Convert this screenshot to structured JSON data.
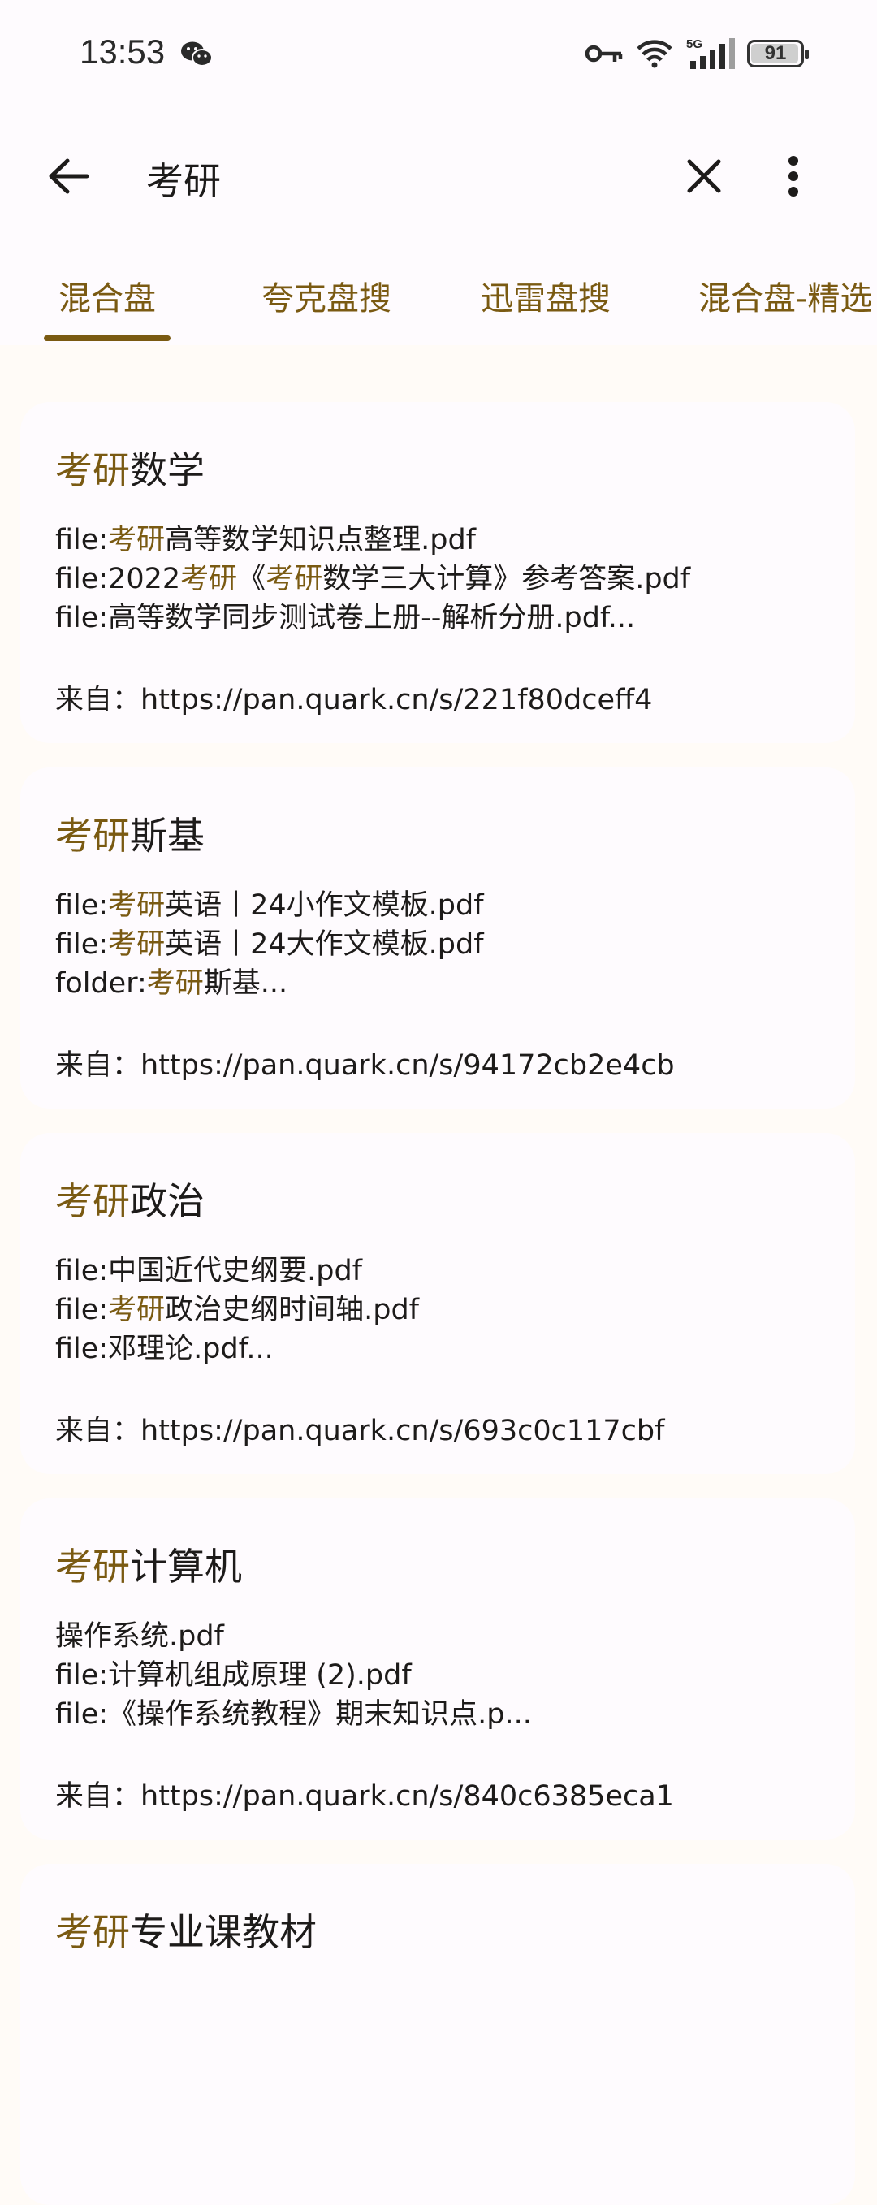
{
  "status_bar": {
    "time": "13:53",
    "icons": [
      "wechat-icon",
      "key-icon",
      "wifi-icon",
      "5g-signal-icon",
      "battery-icon"
    ],
    "network": "5G",
    "battery": "91"
  },
  "app_bar": {
    "query": "考研",
    "icons": [
      "back-arrow-icon",
      "close-icon",
      "more-vert-icon"
    ]
  },
  "tabs": [
    {
      "label": "混合盘",
      "active": true
    },
    {
      "label": "夸克盘搜",
      "active": false
    },
    {
      "label": "迅雷盘搜",
      "active": false
    },
    {
      "label": "混合盘-精选",
      "active": false
    }
  ],
  "results": [
    {
      "title_hl": "考研",
      "title_rest": "数学",
      "lines": [
        [
          {
            "t": "file:"
          },
          {
            "t": "考研",
            "hl": true
          },
          {
            "t": "高等数学知识点整理.pdf"
          }
        ],
        [
          {
            "t": "file:2022"
          },
          {
            "t": "考研",
            "hl": true
          },
          {
            "t": "《"
          },
          {
            "t": "考研",
            "hl": true
          },
          {
            "t": "数学三大计算》参考答案.pdf"
          }
        ],
        [
          {
            "t": "file:高等数学同步测试卷上册--解析分册.pdf..."
          }
        ]
      ],
      "source_label": "来自：",
      "source_url": "https://pan.quark.cn/s/221f80dceff4"
    },
    {
      "title_hl": "考研",
      "title_rest": "斯基",
      "lines": [
        [
          {
            "t": "file:"
          },
          {
            "t": "考研",
            "hl": true
          },
          {
            "t": "英语丨24小作文模板.pdf"
          }
        ],
        [
          {
            "t": "file:"
          },
          {
            "t": "考研",
            "hl": true
          },
          {
            "t": "英语丨24大作文模板.pdf"
          }
        ],
        [
          {
            "t": "folder:"
          },
          {
            "t": "考研",
            "hl": true
          },
          {
            "t": "斯基..."
          }
        ]
      ],
      "source_label": "来自：",
      "source_url": "https://pan.quark.cn/s/94172cb2e4cb"
    },
    {
      "title_hl": "考研",
      "title_rest": "政治",
      "lines": [
        [
          {
            "t": "file:中国近代史纲要.pdf"
          }
        ],
        [
          {
            "t": "file:"
          },
          {
            "t": "考研",
            "hl": true
          },
          {
            "t": "政治史纲时间轴.pdf"
          }
        ],
        [
          {
            "t": "file:邓理论.pdf..."
          }
        ]
      ],
      "source_label": "来自：",
      "source_url": "https://pan.quark.cn/s/693c0c117cbf"
    },
    {
      "title_hl": "考研",
      "title_rest": "计算机",
      "lines": [
        [
          {
            "t": "操作系统.pdf"
          }
        ],
        [
          {
            "t": "file:计算机组成原理 (2).pdf"
          }
        ],
        [
          {
            "t": "file:《操作系统教程》期末知识点.p..."
          }
        ]
      ],
      "source_label": "来自：",
      "source_url": "https://pan.quark.cn/s/840c6385eca1"
    },
    {
      "title_hl": "考研",
      "title_rest": "专业课教材",
      "lines": [],
      "source_label": "",
      "source_url": ""
    }
  ],
  "colors": {
    "accent": "#7a5a12",
    "surface": "#fefbfe",
    "background": "#fffbf7",
    "text": "#1d1b1a"
  }
}
